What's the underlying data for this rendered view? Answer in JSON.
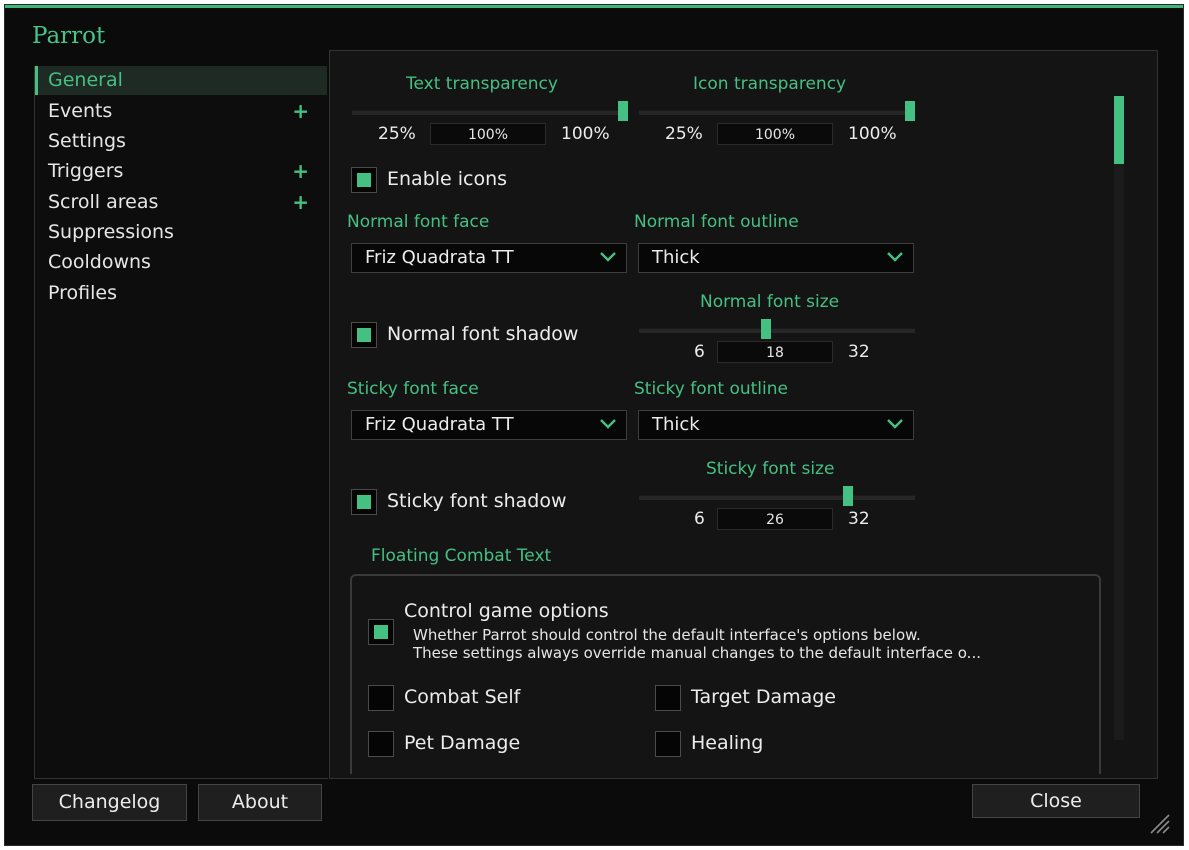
{
  "window": {
    "title": "Parrot"
  },
  "sidebar": {
    "items": [
      {
        "label": "General",
        "expandable": false,
        "selected": true
      },
      {
        "label": "Events",
        "expandable": true
      },
      {
        "label": "Settings",
        "expandable": false
      },
      {
        "label": "Triggers",
        "expandable": true
      },
      {
        "label": "Scroll areas",
        "expandable": true
      },
      {
        "label": "Suppressions",
        "expandable": false
      },
      {
        "label": "Cooldowns",
        "expandable": false
      },
      {
        "label": "Profiles",
        "expandable": false
      }
    ],
    "plus_symbol": "+"
  },
  "general": {
    "text_transparency": {
      "label": "Text transparency",
      "min": "25%",
      "max": "100%",
      "value": "100%",
      "fraction": 1.0
    },
    "icon_transparency": {
      "label": "Icon transparency",
      "min": "25%",
      "max": "100%",
      "value": "100%",
      "fraction": 1.0
    },
    "enable_icons": {
      "label": "Enable icons",
      "checked": true
    },
    "normal_font_face": {
      "label": "Normal font face",
      "value": "Friz Quadrata TT"
    },
    "normal_font_outline": {
      "label": "Normal font outline",
      "value": "Thick"
    },
    "normal_font_shadow": {
      "label": "Normal font shadow",
      "checked": true
    },
    "normal_font_size": {
      "label": "Normal font size",
      "min": "6",
      "max": "32",
      "value": "18"
    },
    "sticky_font_face": {
      "label": "Sticky font face",
      "value": "Friz Quadrata TT"
    },
    "sticky_font_outline": {
      "label": "Sticky font outline",
      "value": "Thick"
    },
    "sticky_font_shadow": {
      "label": "Sticky font shadow",
      "checked": true
    },
    "sticky_font_size": {
      "label": "Sticky font size",
      "min": "6",
      "max": "32",
      "value": "26"
    }
  },
  "fct": {
    "title": "Floating Combat Text",
    "control_game_options": {
      "label": "Control game options",
      "checked": true,
      "desc_line1": "Whether Parrot should control the default interface's options below.",
      "desc_line2": "These settings always override manual changes to the default interface o..."
    },
    "combat_self": {
      "label": "Combat Self",
      "checked": false
    },
    "target_damage": {
      "label": "Target Damage",
      "checked": false
    },
    "pet_damage": {
      "label": "Pet Damage",
      "checked": false
    },
    "healing": {
      "label": "Healing",
      "checked": false
    }
  },
  "footer": {
    "changelog": "Changelog",
    "about": "About",
    "close": "Close"
  },
  "colors": {
    "accent": "#45c083",
    "background": "#0b0b0b",
    "panel": "#141414"
  },
  "icons": {
    "dropdown": "chevron-down-icon",
    "expand": "plus-icon",
    "resize": "resize-grip-icon"
  }
}
